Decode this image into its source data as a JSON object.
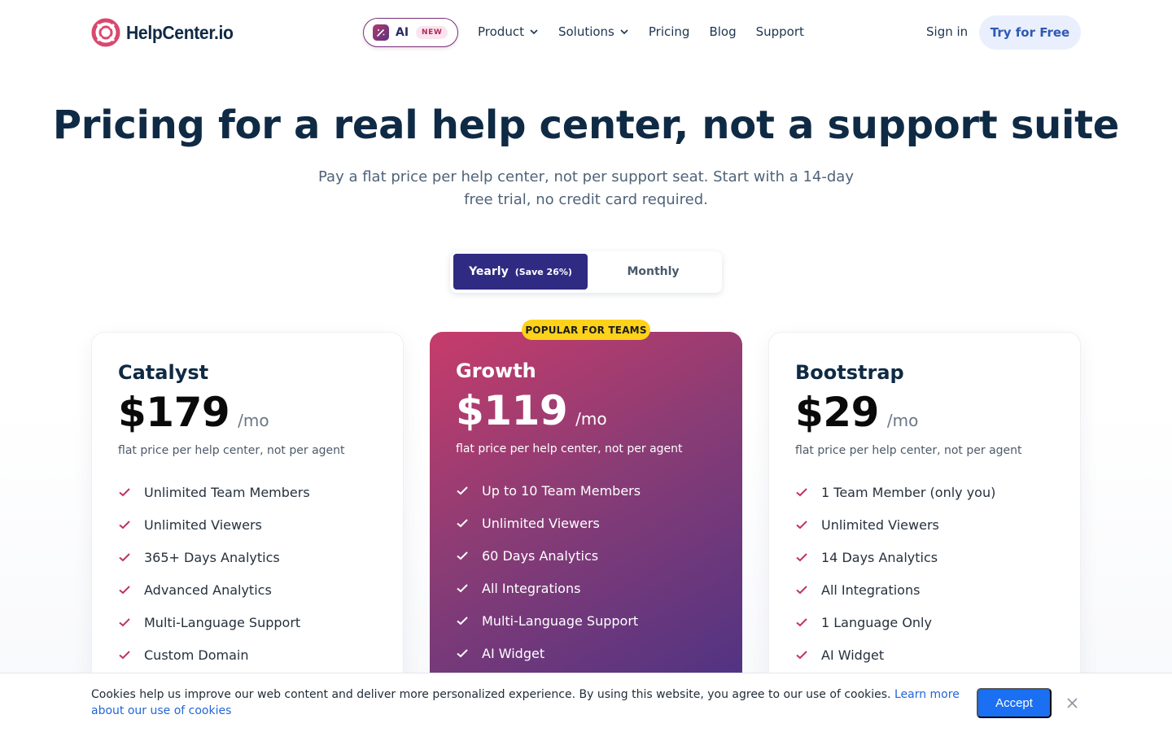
{
  "nav": {
    "brand": "HelpCenter.io",
    "ai_pill": {
      "label": "AI",
      "badge": "NEW"
    },
    "menu": [
      {
        "label": "Product",
        "has_dropdown": true
      },
      {
        "label": "Solutions",
        "has_dropdown": true
      },
      {
        "label": "Pricing",
        "has_dropdown": false
      },
      {
        "label": "Blog",
        "has_dropdown": false
      },
      {
        "label": "Support",
        "has_dropdown": false
      }
    ],
    "sign_in": "Sign in",
    "cta": "Try for Free"
  },
  "hero": {
    "title": "Pricing for a real help center, not a support suite",
    "subtitle": "Pay a flat price per help center, not per support seat. Start with a 14-day free trial, no credit card required."
  },
  "billing_toggle": {
    "yearly_label": "Yearly",
    "yearly_save": "(Save 26%)",
    "monthly_label": "Monthly",
    "selected": "yearly"
  },
  "plans": [
    {
      "name": "Catalyst",
      "price": "$179",
      "period": "/mo",
      "note": "flat price per help center, not per agent",
      "features": [
        "Unlimited Team Members",
        "Unlimited Viewers",
        "365+ Days Analytics",
        "Advanced Analytics",
        "Multi-Language Support",
        "Custom Domain"
      ]
    },
    {
      "name": "Growth",
      "badge": "POPULAR FOR TEAMS",
      "price": "$119",
      "period": "/mo",
      "note": "flat price per help center, not per agent",
      "features": [
        "Up to 10 Team Members",
        "Unlimited Viewers",
        "60 Days Analytics",
        "All Integrations",
        "Multi-Language Support",
        "AI Widget"
      ]
    },
    {
      "name": "Bootstrap",
      "price": "$29",
      "period": "/mo",
      "note": "flat price per help center, not per agent",
      "features": [
        "1 Team Member (only you)",
        "Unlimited Viewers",
        "14 Days Analytics",
        "All Integrations",
        "1 Language Only",
        "AI Widget"
      ]
    }
  ],
  "cookie_bar": {
    "text": "Cookies help us improve our web content and deliver more personalized experience. By using this website, you agree to our use of cookies.",
    "link": "Learn more about our use of cookies",
    "accept": "Accept"
  },
  "icons": {
    "logo": "lifebuoy-icon",
    "ai": "magic-wand-icon",
    "dropdown": "chevron-down-icon",
    "feature": "check-icon",
    "close": "close-icon"
  },
  "colors": {
    "brand_pink": "#c73c6a",
    "brand_purple": "#2f2a82",
    "popular_badge": "#fdd21a",
    "check_color": "#c0345f",
    "accept_button": "#1a6ff2"
  }
}
